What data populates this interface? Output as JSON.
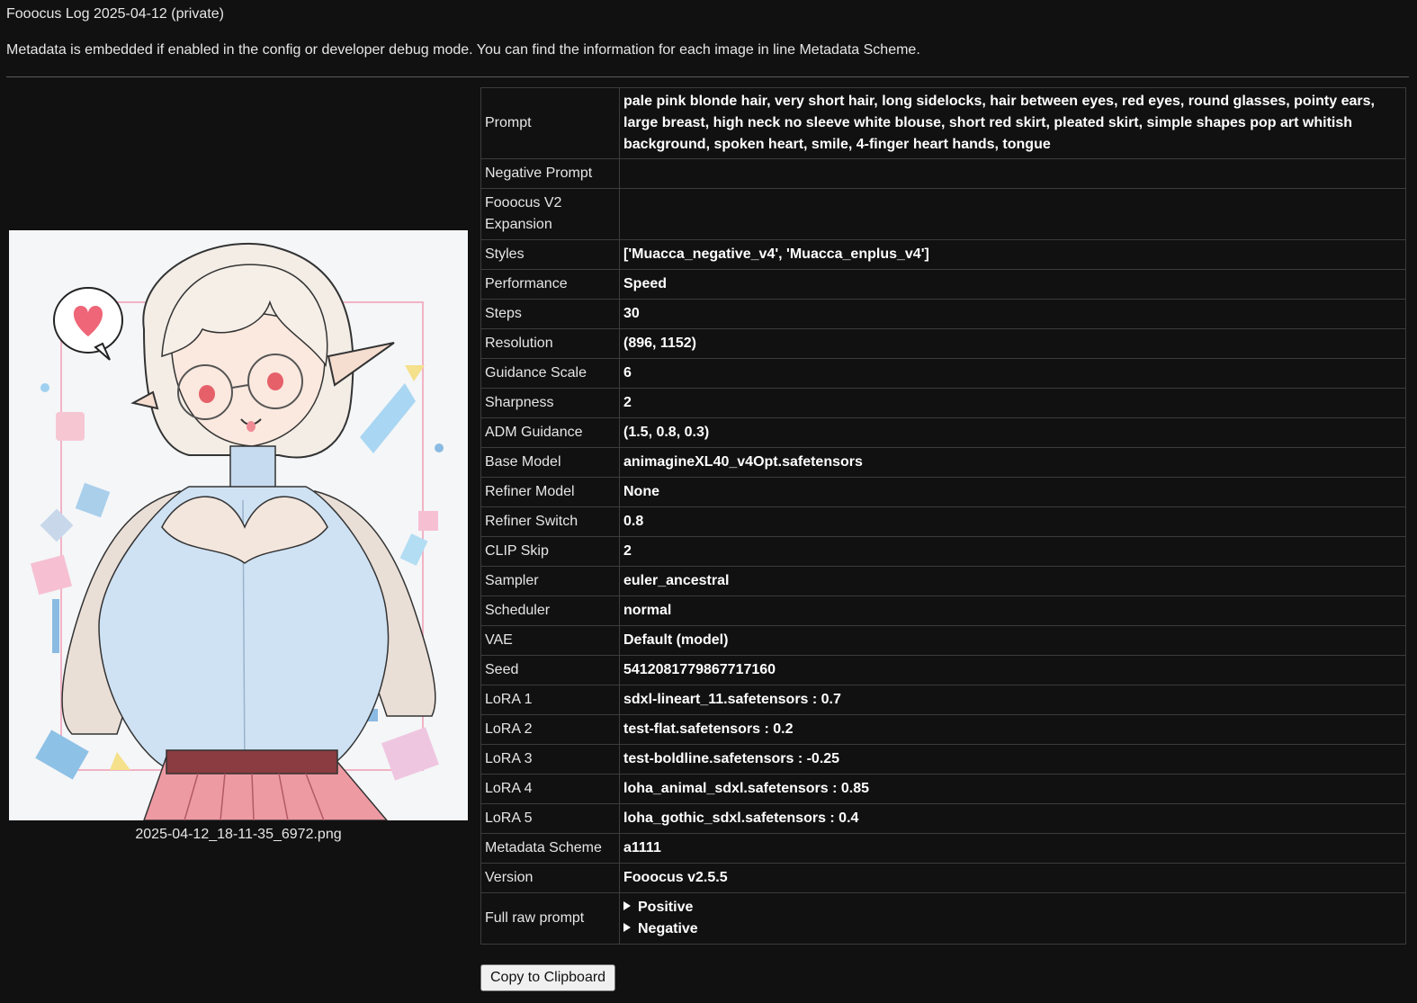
{
  "page": {
    "title": "Fooocus Log 2025-04-12 (private)",
    "intro": "Metadata is embedded if enabled in the config or developer debug mode. You can find the information for each image in line Metadata Scheme."
  },
  "image": {
    "filename": "2025-04-12_18-11-35_6972.png",
    "alt": "anime illustration of a girl making a heart shape with her hands"
  },
  "metadata": [
    {
      "key": "Prompt",
      "value": "pale pink blonde hair, very short hair, long sidelocks, hair between eyes, red eyes, round glasses, pointy ears, large breast, high neck no sleeve white blouse, short red skirt, pleated skirt, simple shapes pop art whitish background, spoken heart, smile, 4-finger heart hands, tongue"
    },
    {
      "key": "Negative Prompt",
      "value": ""
    },
    {
      "key": "Fooocus V2 Expansion",
      "value": ""
    },
    {
      "key": "Styles",
      "value": "['Muacca_negative_v4', 'Muacca_enplus_v4']"
    },
    {
      "key": "Performance",
      "value": "Speed"
    },
    {
      "key": "Steps",
      "value": "30"
    },
    {
      "key": "Resolution",
      "value": "(896, 1152)"
    },
    {
      "key": "Guidance Scale",
      "value": "6"
    },
    {
      "key": "Sharpness",
      "value": "2"
    },
    {
      "key": "ADM Guidance",
      "value": "(1.5, 0.8, 0.3)"
    },
    {
      "key": "Base Model",
      "value": "animagineXL40_v4Opt.safetensors"
    },
    {
      "key": "Refiner Model",
      "value": "None"
    },
    {
      "key": "Refiner Switch",
      "value": "0.8"
    },
    {
      "key": "CLIP Skip",
      "value": "2"
    },
    {
      "key": "Sampler",
      "value": "euler_ancestral"
    },
    {
      "key": "Scheduler",
      "value": "normal"
    },
    {
      "key": "VAE",
      "value": "Default (model)"
    },
    {
      "key": "Seed",
      "value": "5412081779867717160"
    },
    {
      "key": "LoRA 1",
      "value": "sdxl-lineart_11.safetensors : 0.7"
    },
    {
      "key": "LoRA 2",
      "value": "test-flat.safetensors : 0.2"
    },
    {
      "key": "LoRA 3",
      "value": "test-boldline.safetensors : -0.25"
    },
    {
      "key": "LoRA 4",
      "value": "loha_animal_sdxl.safetensors : 0.85"
    },
    {
      "key": "LoRA 5",
      "value": "loha_gothic_sdxl.safetensors : 0.4"
    },
    {
      "key": "Metadata Scheme",
      "value": "a1111"
    },
    {
      "key": "Version",
      "value": "Fooocus v2.5.5"
    }
  ],
  "raw_prompt": {
    "key": "Full raw prompt",
    "positive_label": "Positive",
    "negative_label": "Negative"
  },
  "actions": {
    "copy_label": "Copy to Clipboard"
  }
}
